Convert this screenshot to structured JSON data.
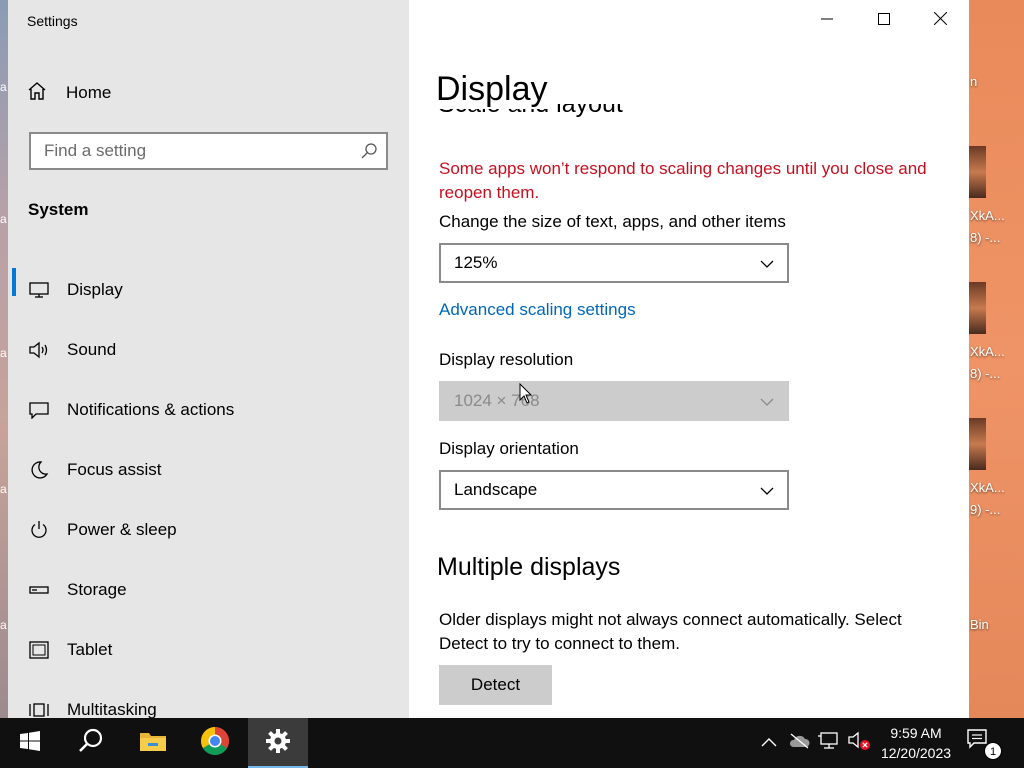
{
  "window": {
    "title": "Settings",
    "controls": {
      "minimize": "minimize",
      "maximize": "maximize",
      "close": "close"
    }
  },
  "sidebar": {
    "home_label": "Home",
    "search_placeholder": "Find a setting",
    "section_title": "System",
    "items": [
      {
        "label": "Display",
        "icon": "monitor-icon",
        "active": true
      },
      {
        "label": "Sound",
        "icon": "speaker-icon"
      },
      {
        "label": "Notifications & actions",
        "icon": "message-icon"
      },
      {
        "label": "Focus assist",
        "icon": "moon-icon"
      },
      {
        "label": "Power & sleep",
        "icon": "power-icon"
      },
      {
        "label": "Storage",
        "icon": "storage-icon"
      },
      {
        "label": "Tablet",
        "icon": "tablet-icon"
      },
      {
        "label": "Multitasking",
        "icon": "multitasking-icon"
      }
    ]
  },
  "main": {
    "page_title": "Display",
    "scrolled_heading": "Scale and layout",
    "scaling_warning": "Some apps won’t respond to scaling changes until you close and reopen them.",
    "scale_label": "Change the size of text, apps, and other items",
    "scale_value": "125%",
    "advanced_scaling_link": "Advanced scaling settings",
    "resolution_label": "Display resolution",
    "resolution_value": "1024 × 768",
    "orientation_label": "Display orientation",
    "orientation_value": "Landscape",
    "multiple_displays_heading": "Multiple displays",
    "multiple_displays_text": "Older displays might not always connect automatically. Select Detect to try to connect to them.",
    "detect_button": "Detect"
  },
  "desktop": {
    "icon_fragments": [
      "n",
      "XkA...",
      "8) -...",
      "XkA...",
      "8) -...",
      "XkA...",
      "9) -...",
      "Bin"
    ],
    "left_fragments": [
      "a",
      "a",
      "a",
      "a",
      "a"
    ]
  },
  "taskbar": {
    "time": "9:59 AM",
    "date": "12/20/2023",
    "notification_count": "1",
    "accent_color": "#76b9ed"
  },
  "colors": {
    "accent": "#0078d4",
    "link": "#0067b8",
    "warning": "#c50f1f"
  }
}
